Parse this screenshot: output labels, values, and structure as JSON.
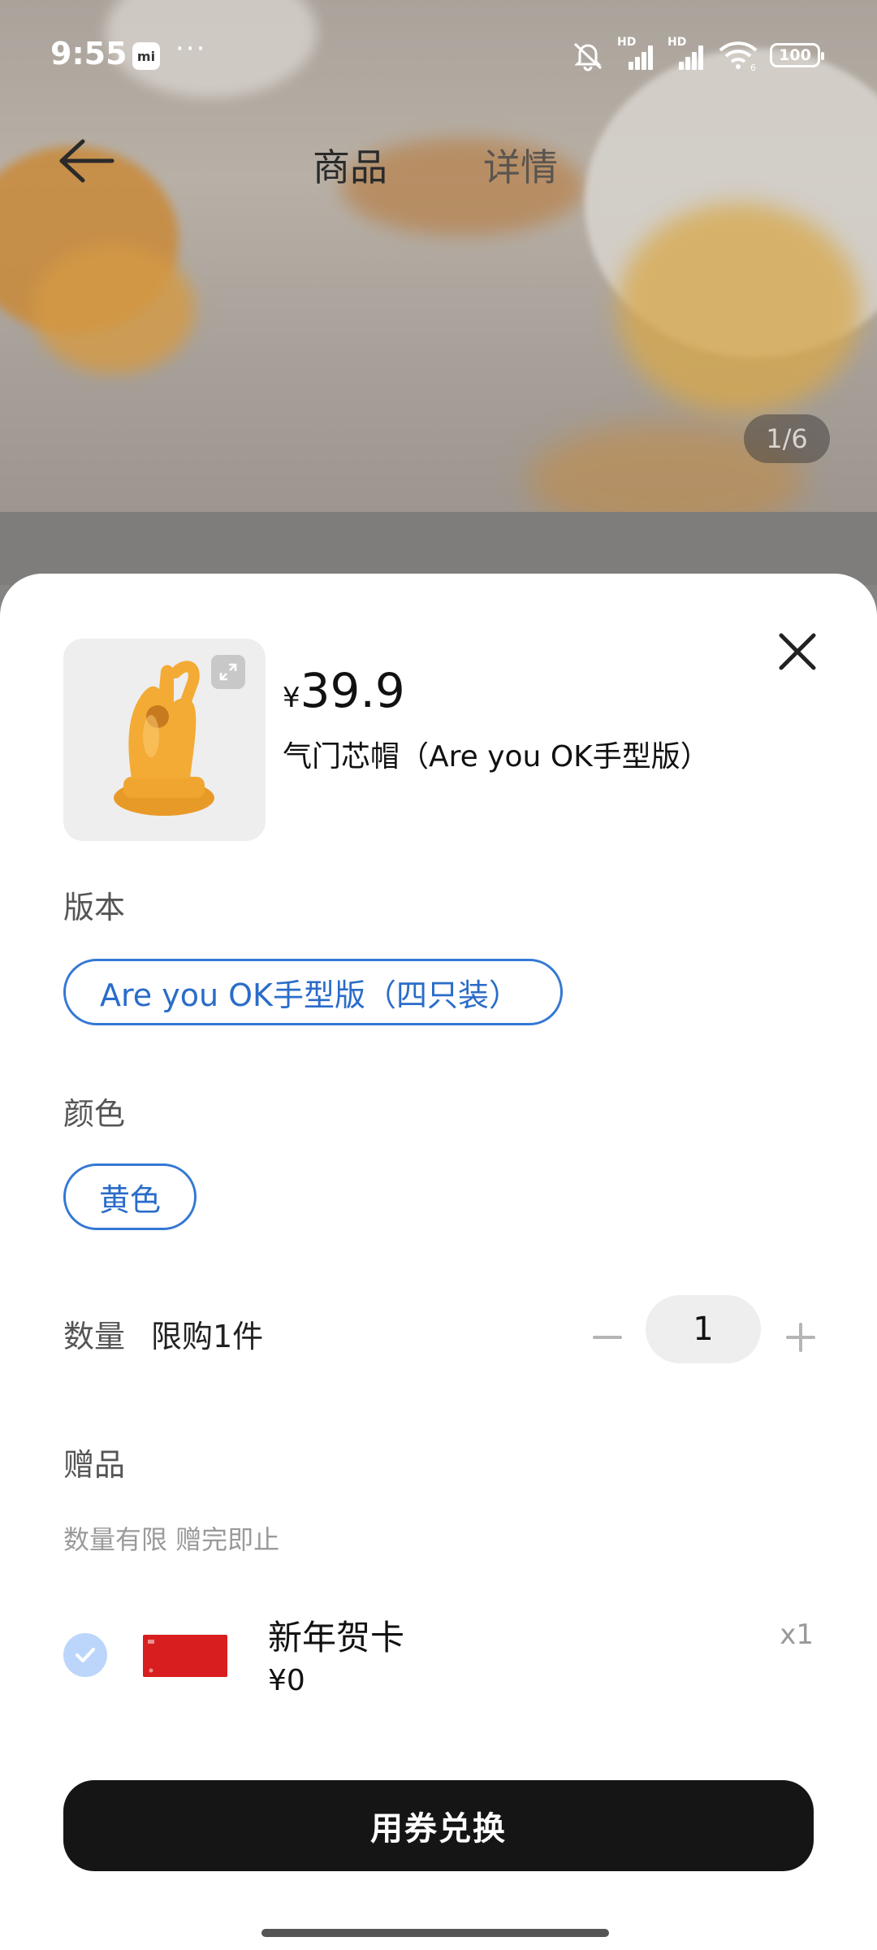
{
  "status_bar": {
    "time": "9:55",
    "app_badge": "mi",
    "more": "···",
    "signal_hd_1": "HD",
    "signal_hd_2": "HD",
    "wifi_sub": "6",
    "battery": "100"
  },
  "nav": {
    "tabs": [
      {
        "label": "商品",
        "active": true
      },
      {
        "label": "详情",
        "active": false
      }
    ]
  },
  "gallery": {
    "indicator": "1/6"
  },
  "sheet": {
    "price_symbol": "¥",
    "price": "39.9",
    "product_name": "气门芯帽（Are you OK手型版）",
    "version": {
      "label": "版本",
      "selected": "Are you OK手型版（四只装）"
    },
    "color": {
      "label": "颜色",
      "selected": "黄色"
    },
    "quantity": {
      "label": "数量",
      "limit": "限购1件",
      "value": "1"
    },
    "gift": {
      "label": "赠品",
      "note": "数量有限 赠完即止",
      "item": {
        "name": "新年贺卡",
        "price": "¥0",
        "count": "x1",
        "checked": true
      }
    },
    "redeem_button": "用券兑换"
  },
  "colors": {
    "accent_blue": "#3478d4",
    "button_black": "#151515",
    "gift_card_red": "#d81e1e",
    "product_yellow": "#f0a530"
  }
}
